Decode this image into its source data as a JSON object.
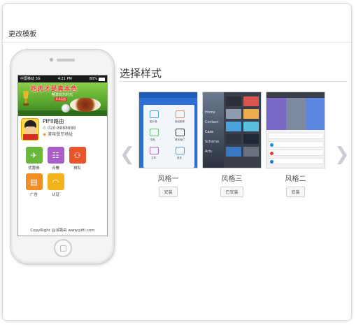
{
  "page": {
    "title": "更改模板"
  },
  "phone": {
    "status": {
      "carrier": "中国移动",
      "network": "3G",
      "time": "4:21 PM",
      "battery": "80%"
    },
    "banner": {
      "headline": "吃肉才是真本色",
      "subline": "畅享欢乐时光",
      "price": "8.8元起"
    },
    "store": {
      "name": "PIFII路由",
      "phone": "020-8888888",
      "address": "美味餐厅地址"
    },
    "tiles": [
      {
        "label": "优惠券",
        "color": "#6ab83a",
        "icon": "ticket-icon",
        "glyph": "✈"
      },
      {
        "label": "点餐",
        "color": "#a95fc7",
        "icon": "menu-icon",
        "glyph": "☷"
      },
      {
        "label": "排队",
        "color": "#e8552c",
        "icon": "queue-icon",
        "glyph": "⚇"
      },
      {
        "label": "广告",
        "color": "#f08f24",
        "icon": "ad-icon",
        "glyph": "▤"
      },
      {
        "label": "认证",
        "color": "#f3b31b",
        "icon": "wifi-icon",
        "glyph": "◠"
      }
    ],
    "footer": "CopyRight @派路由    www.pifii.com"
  },
  "panel": {
    "heading": "选择样式",
    "styles": [
      {
        "name": "风格一",
        "button": "安装"
      },
      {
        "name": "风格三",
        "button": "已安装"
      },
      {
        "name": "风格二",
        "button": "安装"
      }
    ],
    "thumb1_labels": [
      "图片墙",
      "新品推荐",
      "导航",
      "联系我们",
      "文章",
      "更多"
    ],
    "thumb2_labels": [
      "Home",
      "Contact",
      "Case",
      "Scheme",
      "Arts"
    ]
  },
  "colors": {
    "accent": "#2d6fd3",
    "phone_bezel": "#f4f4f4",
    "arrow": "#c8cdd3"
  }
}
